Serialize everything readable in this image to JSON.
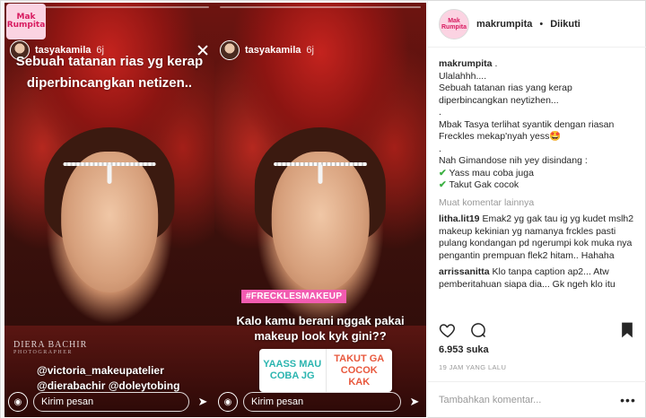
{
  "logo": {
    "text": "Mak Rumpita"
  },
  "story_one": {
    "username": "tasyakamila",
    "time": "6j",
    "caption": "Sebuah tatanan rias yg kerap diperbincangkan netizen..",
    "watermark": "DIERA BACHIR",
    "watermark_sub": "PHOTOGRAPHER",
    "mentions": [
      "@victoria_makeupatelier",
      "@dierabachir @doleytobing"
    ],
    "reply_placeholder": "Kirim pesan"
  },
  "story_two": {
    "username": "tasyakamila",
    "time": "6j",
    "tag": "#FRECKLESMAKEUP",
    "caption": "Kalo kamu berani nggak pakai makeup look kyk gini??",
    "poll_yes": "YAASS MAU COBA JG",
    "poll_no": "TAKUT GA COCOK KAK",
    "reply_placeholder": "Kirim pesan"
  },
  "panel": {
    "username": "makrumpita",
    "separator": "•",
    "follow_status": "Diikuti",
    "caption_user": "makrumpita",
    "caption_lines": [
      ".",
      "Ulalahhh....",
      "Sebuah tatanan rias yang kerap diperbincangkan neytizhen...",
      ".",
      "Mbak Tasya terlihat syantik dengan riasan Freckles mekap'nyah yess🤩",
      ".",
      "Nah Gimandose nih yey disindang :"
    ],
    "options": [
      "Yass mau coba juga",
      "Takut Gak cocok"
    ],
    "more_comments": "Muat komentar lainnya",
    "comments": [
      {
        "user": "litha.lit19",
        "text": "Emak2 yg gak tau ig yg kudet mslh2 makeup kekinian yg namanya frckles pasti pulang kondangan pd ngerumpi kok muka nya pengantin prempuan flek2 hitam.. Hahaha"
      },
      {
        "user": "arrissanitta",
        "text": "Klo tanpa caption ap2... Atw pemberitahuan siapa dia... Gk ngeh klo itu"
      }
    ],
    "likes": "6.953 suka",
    "timestamp": "19 JAM YANG LALU",
    "add_comment_placeholder": "Tambahkan komentar...",
    "more_label": "•••"
  }
}
